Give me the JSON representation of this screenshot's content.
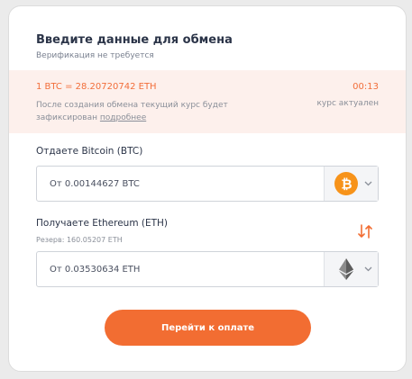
{
  "header": {
    "title": "Введите данные для обмена",
    "subtitle": "Верификация не требуется"
  },
  "rate": {
    "text": "1 BTC = 28.20720742 ETH",
    "timer": "00:13",
    "note": "После создания обмена текущий курс будет зафиксирован",
    "link": "подробнее",
    "status": "курс актуален"
  },
  "give": {
    "label": "Отдаете Bitcoin (BTC)",
    "value": "От 0.00144627 BTC",
    "coin_icon": "bitcoin-icon"
  },
  "receive": {
    "label": "Получаете Ethereum (ETH)",
    "reserve": "Резерв: 160.05207 ETH",
    "value": "От 0.03530634 ETH",
    "coin_icon": "ethereum-icon"
  },
  "actions": {
    "submit_label": "Перейти к оплате",
    "swap_icon": "swap-arrows-icon"
  },
  "colors": {
    "accent": "#f26d32",
    "rate_bg": "#fdf0ec",
    "text_dark": "#2b3448",
    "text_muted": "#8a8f99"
  }
}
